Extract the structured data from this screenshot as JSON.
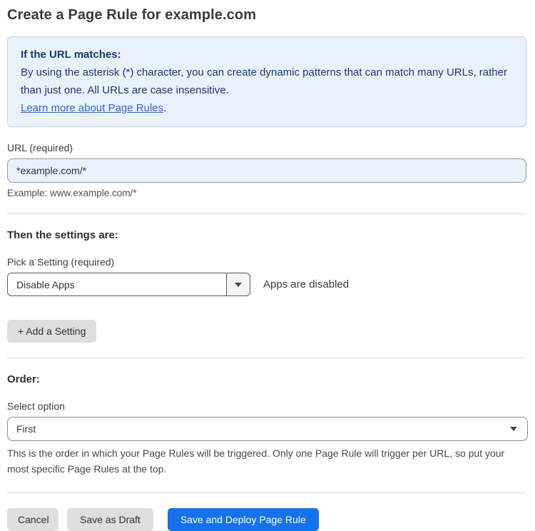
{
  "title": "Create a Page Rule for example.com",
  "info_box": {
    "heading": "If the URL matches:",
    "body": "By using the asterisk (*) character, you can create dynamic patterns that can match many URLs, rather than just one. All URLs are case insensitive.",
    "link": "Learn more about Page Rules",
    "link_suffix": "."
  },
  "url_field": {
    "label": "URL (required)",
    "value": "*example.com/*",
    "hint": "Example: www.example.com/*"
  },
  "settings": {
    "heading": "Then the settings are:",
    "picker_label": "Pick a Setting (required)",
    "selected_setting": "Disable Apps",
    "description": "Apps are disabled",
    "add_button": "+ Add a Setting"
  },
  "order": {
    "heading": "Order:",
    "label": "Select option",
    "selected_option": "First",
    "hint": "This is the order in which your Page Rules will be triggered. Only one Page Rule will trigger per URL, so put your most specific Page Rules at the top."
  },
  "actions": {
    "cancel": "Cancel",
    "save_draft": "Save as Draft",
    "save_deploy": "Save and Deploy Page Rule"
  },
  "colors": {
    "accent_blue": "#1672ec",
    "info_background": "#e9f1fb",
    "info_border": "#b9d4f0",
    "info_text": "#1b3a70",
    "link_blue": "#3366cc",
    "input_background": "#e9f1fc"
  }
}
